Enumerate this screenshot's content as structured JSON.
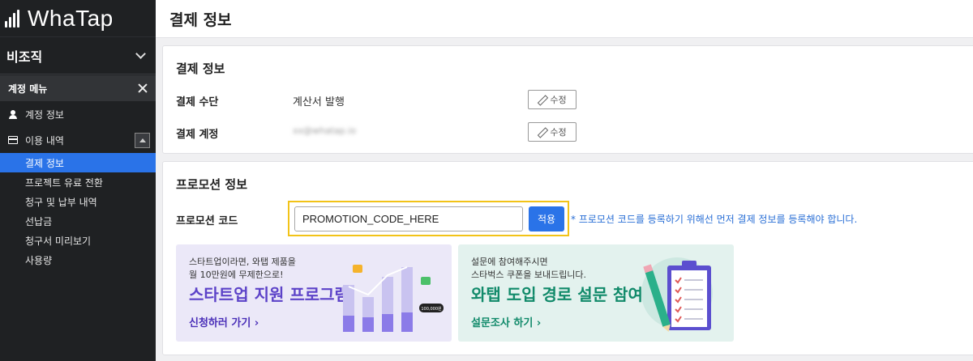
{
  "app": {
    "logo_text": "WhaTap"
  },
  "sidebar": {
    "org_name": "비조직",
    "menu_header": "계정 메뉴",
    "items": [
      {
        "label": "계정 정보",
        "icon": "person-icon"
      },
      {
        "label": "이용 내역",
        "icon": "card-icon"
      }
    ],
    "sub_items": [
      {
        "label": "결제 정보",
        "active": true
      },
      {
        "label": "프로젝트 유료 전환"
      },
      {
        "label": "청구 및 납부 내역"
      },
      {
        "label": "선납금"
      },
      {
        "label": "청구서 미리보기"
      },
      {
        "label": "사용량"
      }
    ]
  },
  "page": {
    "title": "결제 정보"
  },
  "payment": {
    "title": "결제 정보",
    "method_label": "결제 수단",
    "method_value": "계산서 발행",
    "account_label": "결제 계정",
    "account_value": "xx@whatap.io",
    "edit_label": "수정"
  },
  "promotion": {
    "title": "프로모션 정보",
    "code_label": "프로모션 코드",
    "code_value": "PROMOTION_CODE_HERE",
    "apply_label": "적용",
    "note": "* 프로모션 코드를 등록하기 위해선 먼저 결제 정보를 등록해야 합니다."
  },
  "banners": {
    "startup": {
      "small": "스타트업이라면, 와탭 제품을\n월 10만원에 무제한으로!",
      "big": "스타트업 지원 프로그램",
      "link": "신청하러 가기",
      "badge": "100,000원"
    },
    "survey": {
      "small": "설문에 참여해주시면\n스타벅스 쿠폰을 보내드립니다.",
      "big": "와탭 도입 경로 설문 참여",
      "link": "설문조사 하기"
    }
  },
  "colors": {
    "accent": "#2a73e8",
    "sidebar_bg": "#1f2123",
    "highlight": "#f2c318"
  }
}
